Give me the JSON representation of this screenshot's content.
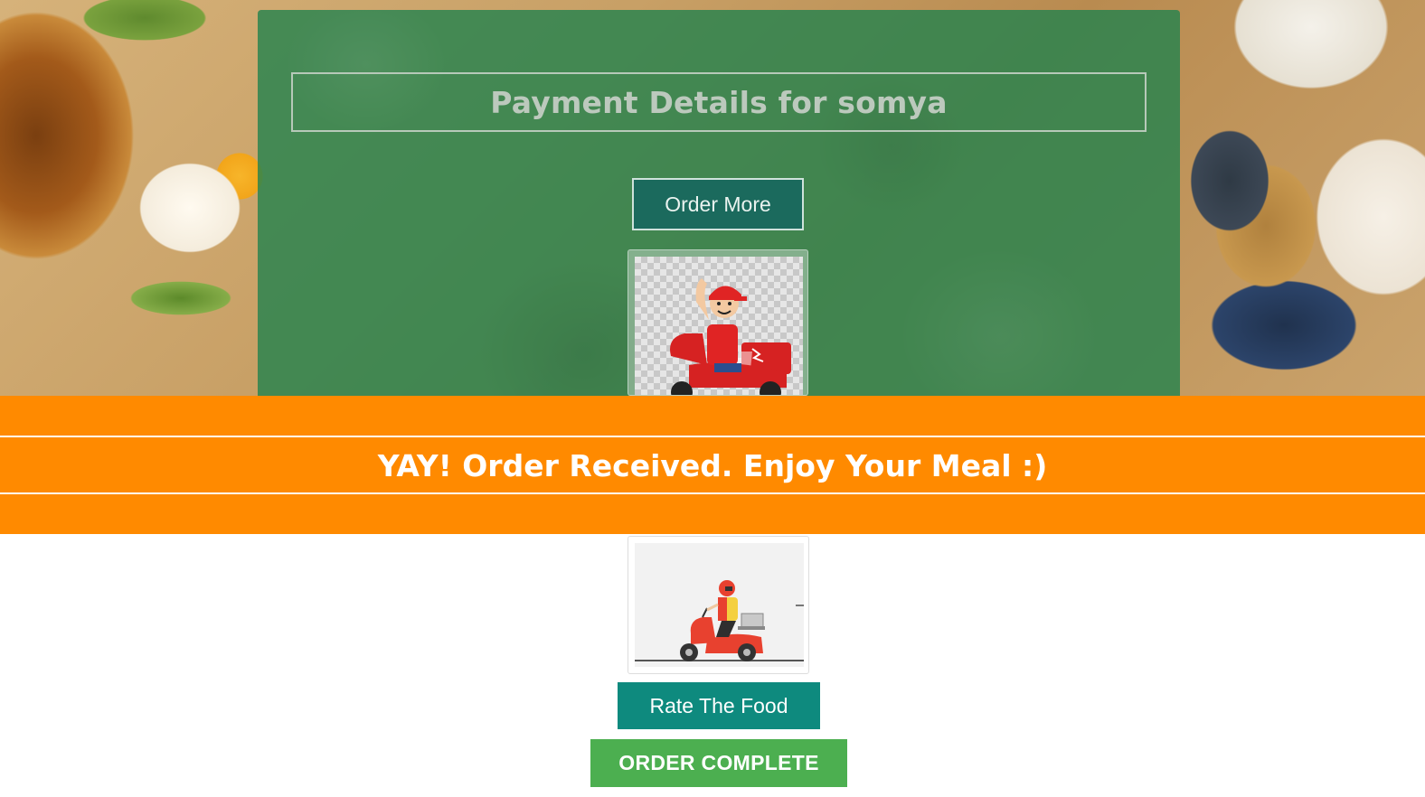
{
  "header": {
    "title": "Payment Details for somya"
  },
  "actions": {
    "order_more_label": "Order More",
    "rate_food_label": "Rate The Food",
    "order_complete_label": "ORDER COMPLETE"
  },
  "banner": {
    "message": "YAY! Order Received. Enjoy Your Meal :)"
  },
  "images": {
    "top": "delivery-boy-waving-scooter",
    "bottom": "delivery-rider-scooter"
  },
  "colors": {
    "panel": "#26824e",
    "banner": "#ff8a00",
    "order_more_bg": "#1b6a5d",
    "rate_bg": "#0e8a7e",
    "complete_bg": "#4caf50"
  }
}
